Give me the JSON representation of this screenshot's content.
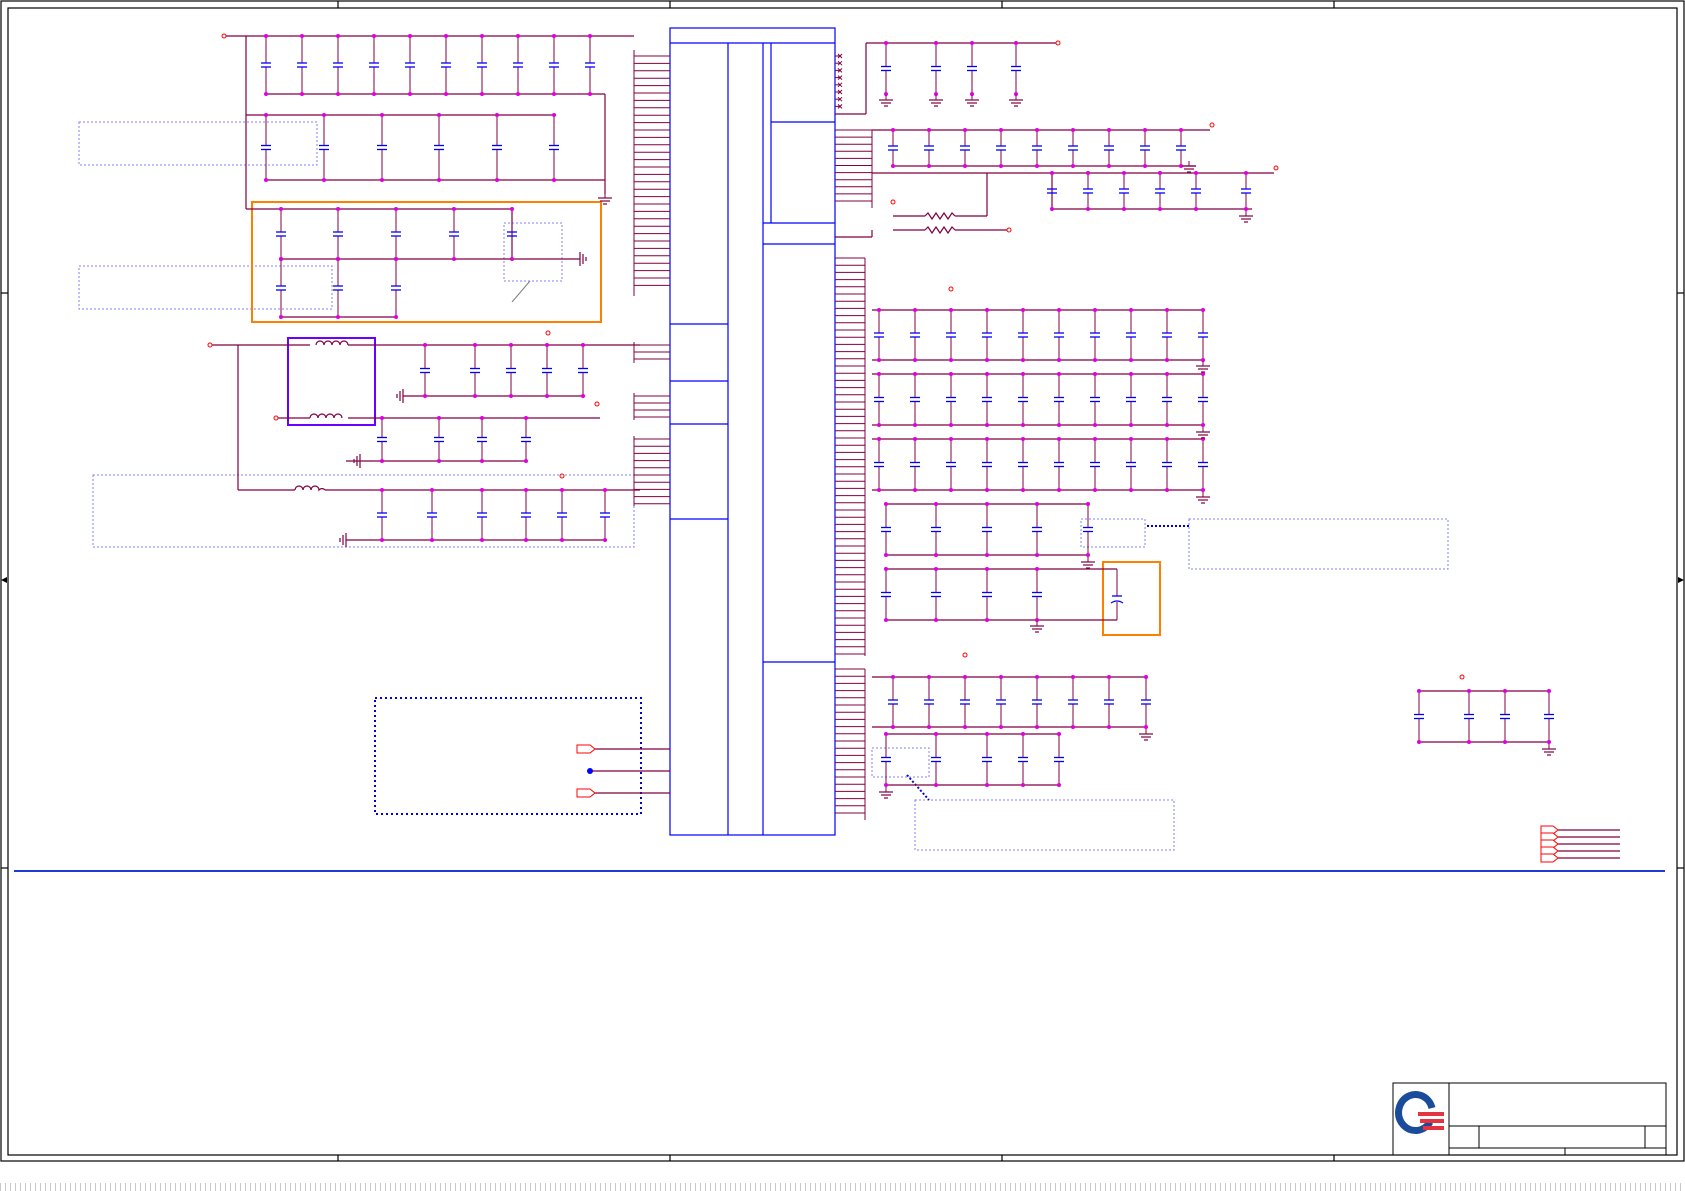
{
  "colors": {
    "border": "#000000",
    "wire": "#800040",
    "component": "#0000ff",
    "net": "#ff0000",
    "junction": "#e000e0",
    "highlight": "#ff8000",
    "inductor_box": "#6a00ff",
    "note_box": "#8080ff",
    "logo_blue": "#1b4c9c",
    "logo_red": "#e63340"
  },
  "icons": {
    "company_logo": "quanta-logo-icon",
    "ground": "ground-icon",
    "capacitor": "capacitor-icon",
    "inductor": "inductor-icon",
    "resistor": "resistor-icon",
    "power_flag": "power-flag-icon",
    "offpage_connector": "offpage-connector-icon"
  }
}
